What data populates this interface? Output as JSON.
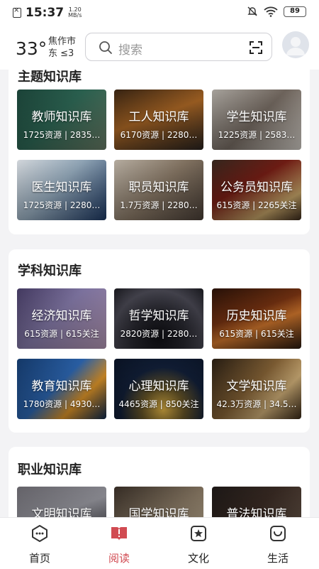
{
  "status": {
    "time": "15:37",
    "speed_top": "1.20",
    "speed_bottom": "MB/s",
    "battery": "89"
  },
  "header": {
    "temperature": "33°",
    "city": "焦作市",
    "wind": "东 ≤3",
    "search_placeholder": "搜索"
  },
  "sections": [
    {
      "title": "主题知识库",
      "cards": [
        {
          "title": "教师知识库",
          "sub": "1725资源 | 2835…"
        },
        {
          "title": "工人知识库",
          "sub": "6170资源 | 2280…"
        },
        {
          "title": "学生知识库",
          "sub": "1225资源 | 2583…"
        },
        {
          "title": "医生知识库",
          "sub": "1725资源 | 2280…"
        },
        {
          "title": "职员知识库",
          "sub": "1.7万资源 | 2280…"
        },
        {
          "title": "公务员知识库",
          "sub": "615资源 | 2265关注"
        }
      ]
    },
    {
      "title": "学科知识库",
      "cards": [
        {
          "title": "经济知识库",
          "sub": "615资源 | 615关注"
        },
        {
          "title": "哲学知识库",
          "sub": "2820资源 | 2280…"
        },
        {
          "title": "历史知识库",
          "sub": "615资源 | 615关注"
        },
        {
          "title": "教育知识库",
          "sub": "1780资源 | 4930…"
        },
        {
          "title": "心理知识库",
          "sub": "4465资源 | 850关注"
        },
        {
          "title": "文学知识库",
          "sub": "42.3万资源 | 34.5…"
        }
      ]
    },
    {
      "title": "职业知识库",
      "cards": [
        {
          "title": "文明知识库",
          "sub": ""
        },
        {
          "title": "国学知识库",
          "sub": ""
        },
        {
          "title": "普法知识库",
          "sub": ""
        }
      ]
    }
  ],
  "nav": [
    {
      "label": "首页",
      "icon": "home-icon"
    },
    {
      "label": "阅读",
      "icon": "read-icon"
    },
    {
      "label": "文化",
      "icon": "culture-icon"
    },
    {
      "label": "生活",
      "icon": "life-icon"
    }
  ],
  "colors": {
    "accent": "#d14b52",
    "background": "#f3f3f5"
  }
}
